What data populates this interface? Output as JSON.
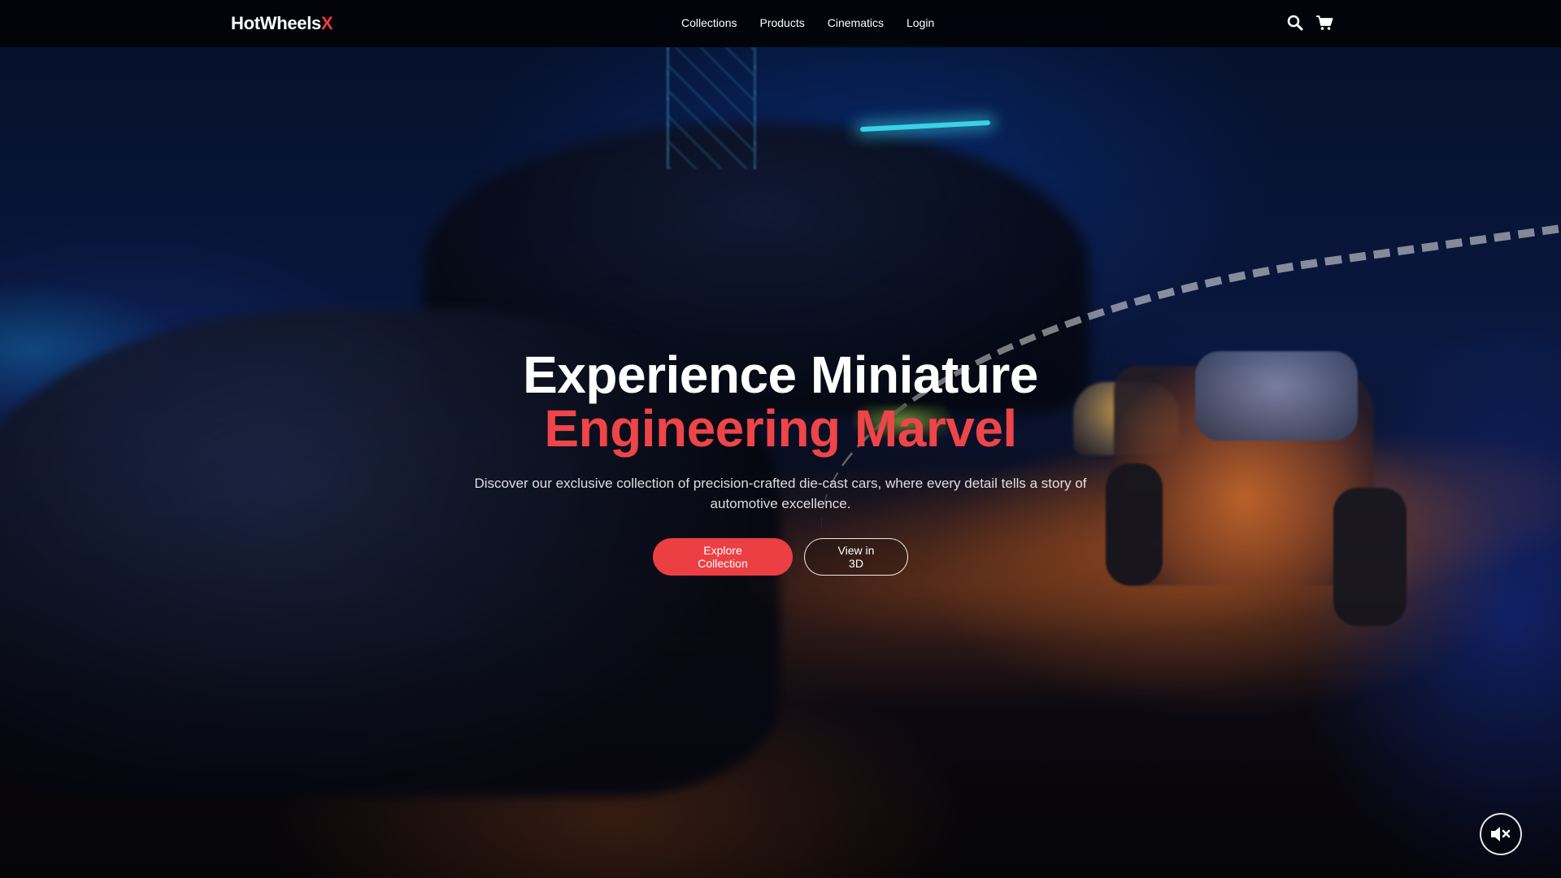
{
  "brand": {
    "name": "HotWheels",
    "accent": "X",
    "accent_color": "#ef3b3e"
  },
  "nav": {
    "links": [
      {
        "label": "Collections"
      },
      {
        "label": "Products"
      },
      {
        "label": "Cinematics"
      },
      {
        "label": "Login"
      }
    ],
    "icons": [
      "search-icon",
      "cart-icon"
    ]
  },
  "hero": {
    "headline_line1": "Experience Miniature",
    "headline_line2": "Engineering Marvel",
    "headline_accent_color": "#ef4448",
    "subtitle": "Discover our exclusive collection of precision-crafted die-cast cars, where every detail tells a story of automotive excellence.",
    "primary_cta": "Explore Collection",
    "secondary_cta": "View in 3D",
    "primary_cta_color": "#ec3f43"
  },
  "media": {
    "mute_icon": "speaker-muted-icon"
  }
}
